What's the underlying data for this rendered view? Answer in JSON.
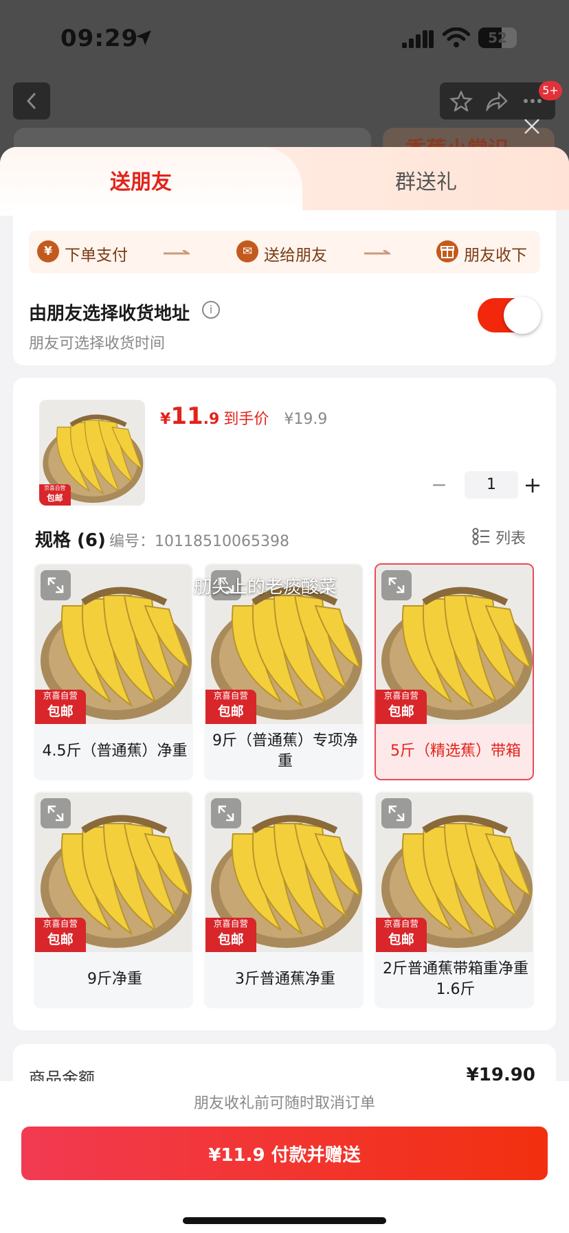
{
  "status_bar": {
    "time": "09:29",
    "battery": "52"
  },
  "header": {
    "notification_badge": "5+",
    "bg_banner_text": "香蕉小常识"
  },
  "tabs": [
    {
      "label": "送朋友",
      "active": true
    },
    {
      "label": "群送礼",
      "active": false
    }
  ],
  "flow": {
    "steps": [
      {
        "icon": "¥",
        "label": "下单支付"
      },
      {
        "icon": "✉",
        "label": "送给朋友"
      },
      {
        "icon": "🎁",
        "label": "朋友收下"
      }
    ]
  },
  "address_option": {
    "title": "由朋友选择收货地址",
    "info_icon": "i",
    "subtitle": "朋友可选择收货时间",
    "enabled": true
  },
  "product": {
    "price_symbol": "¥",
    "price_int": "11",
    "price_dec": ".9",
    "price_tag": "到手价",
    "original_price": "¥19.9",
    "quantity": "1",
    "minus": "−",
    "plus": "+",
    "thumb_badge_top": "京喜自营",
    "thumb_badge_bottom": "包邮"
  },
  "specs": {
    "title": "规格 (6)",
    "code": "编号：10118510065398",
    "list_toggle": "列表",
    "badge_top": "京喜自营",
    "badge_bottom": "包邮",
    "overlay_text": "舠尖上的老痰酸菜",
    "items": [
      {
        "label": "4.5斤（普通蕉）净重",
        "selected": false
      },
      {
        "label": "9斤（普通蕉）专项净重",
        "selected": false
      },
      {
        "label": "5斤（精选蕉）带箱",
        "selected": true
      },
      {
        "label": "9斤净重",
        "selected": false
      },
      {
        "label": "3斤普通蕉净重",
        "selected": false
      },
      {
        "label": "2斤普通蕉带箱重净重1.6斤",
        "selected": false
      }
    ]
  },
  "summary": {
    "label": "商品金额",
    "value": "¥19.90"
  },
  "bottom": {
    "note": "朋友收礼前可随时取消订单",
    "pay_button": "¥11.9 付款并赠送"
  },
  "colors": {
    "accent": "#e2231a",
    "flow_bg": "#fff4ee",
    "flow_icon": "#c35a1d",
    "banana": "#f3cf3c"
  }
}
